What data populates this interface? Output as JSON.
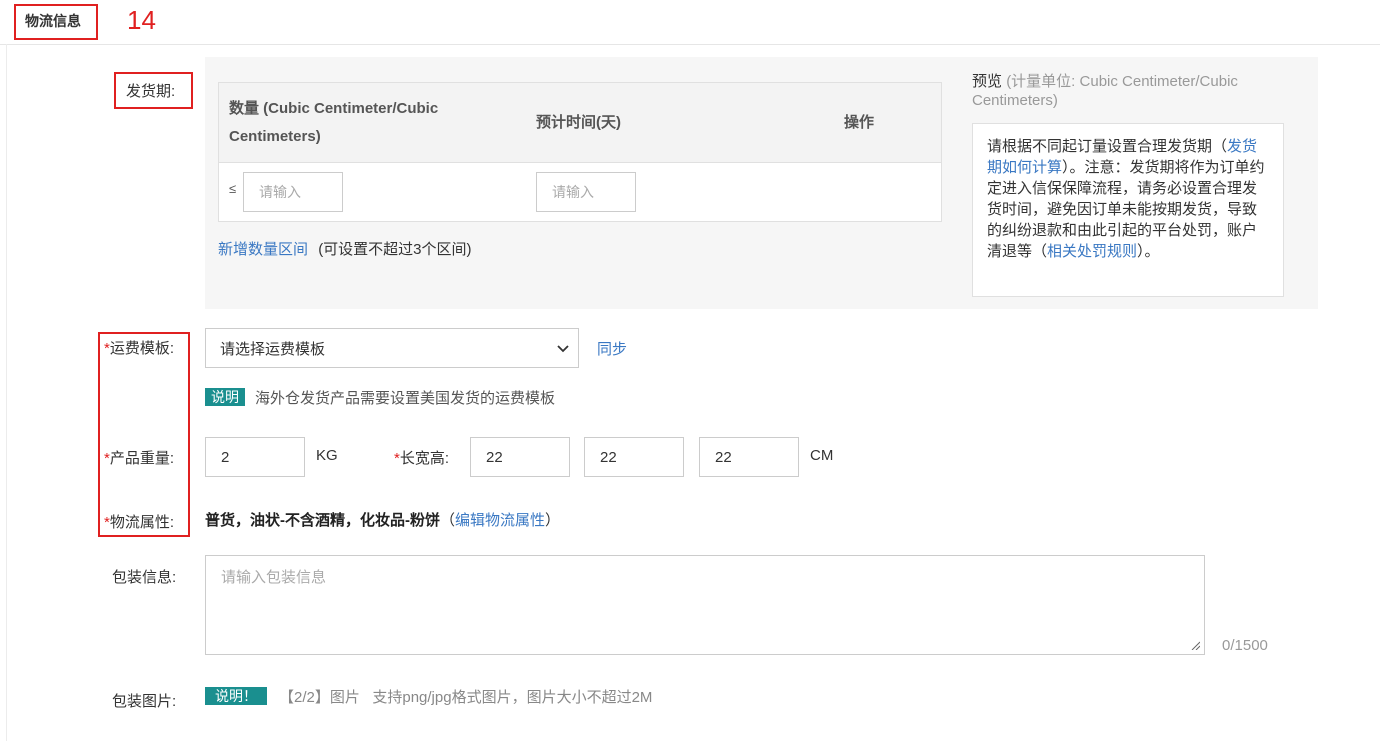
{
  "section": {
    "title": "物流信息",
    "annotation_number": "14"
  },
  "delivery": {
    "label": "发货期:",
    "table": {
      "header_qty": "数量 (Cubic Centimeter/Cubic Centimeters)",
      "header_time": "预计时间(天)",
      "header_action": "操作",
      "row_prefix": "≤",
      "qty_placeholder": "请输入",
      "time_placeholder": "请输入"
    },
    "add_link": "新增数量区间",
    "add_note": "(可设置不超过3个区间)",
    "preview_title": "预览",
    "preview_unit": "(计量单位: Cubic Centimeter/Cubic Centimeters)",
    "preview_text_1": "请根据不同起订量设置合理发货期（",
    "preview_link_1": "发货期如何计算",
    "preview_text_2": "）。注意：发货期将作为订单约定进入信保保障流程，请务必设置合理发货时间，避免因订单未能按期发货，导致的纠纷退款和由此引起的平台处罚，账户清退等（",
    "preview_link_2": "相关处罚规则",
    "preview_text_3": "）。"
  },
  "shipping": {
    "label": "运费模板:",
    "select_value": "请选择运费模板",
    "sync_link": "同步",
    "badge": "说明",
    "note": "海外仓发货产品需要设置美国发货的运费模板"
  },
  "weight": {
    "label": "产品重量:",
    "value": "2",
    "unit": "KG"
  },
  "dims": {
    "label": "长宽高:",
    "length": "22",
    "width": "22",
    "height": "22",
    "unit": "CM"
  },
  "logistics_attr": {
    "label": "物流属性:",
    "value": "普货，油状-不含酒精，化妆品-粉饼",
    "paren_open": "（",
    "edit_link": "编辑物流属性",
    "paren_close": "）"
  },
  "packing_info": {
    "label": "包装信息:",
    "placeholder": "请输入包装信息",
    "counter": "0/1500"
  },
  "packing_images": {
    "label": "包装图片:",
    "badge": "说明！",
    "note": "【2/2】图片   支持png/jpg格式图片，图片大小不超过2M"
  },
  "colors": {
    "required": "#e02020",
    "link": "#3a78c3",
    "badge": "#1a8f8f",
    "annotation": "#e02020"
  }
}
